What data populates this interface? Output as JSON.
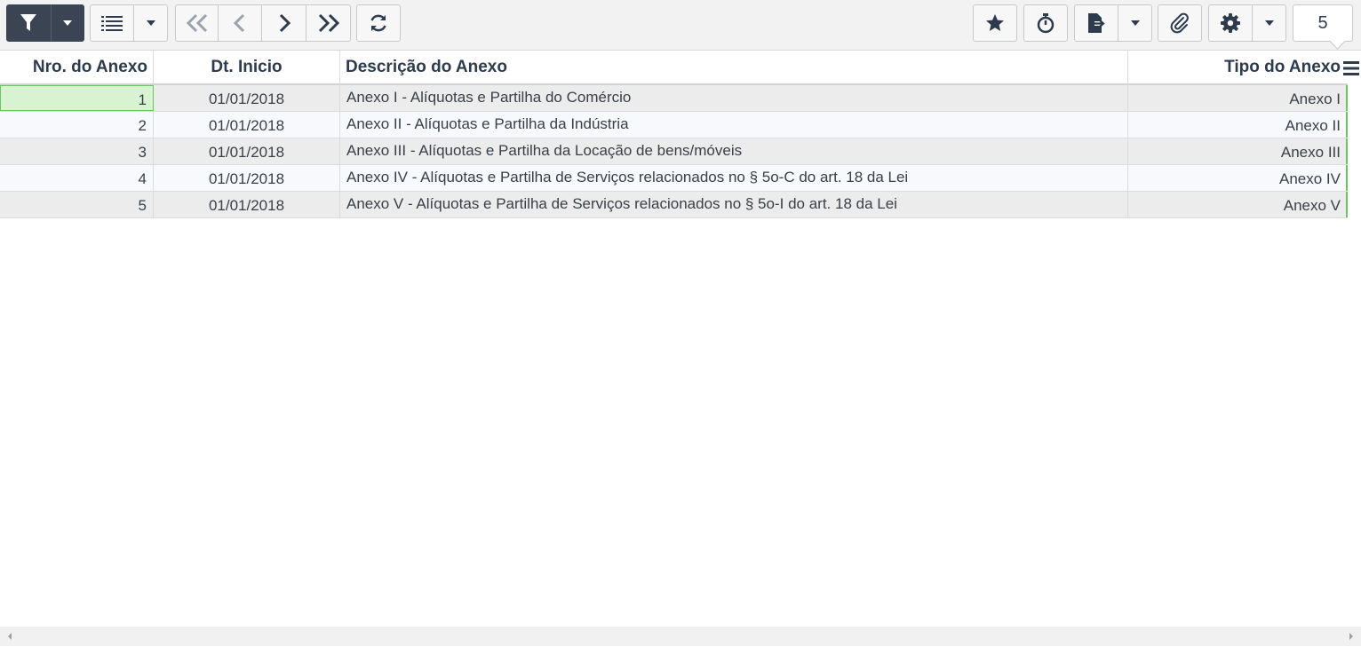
{
  "toolbar": {
    "buttons": [
      {
        "name": "filter-button",
        "icon": "filter-icon"
      },
      {
        "name": "filter-dropdown-button",
        "icon": "caret-down-icon"
      },
      {
        "name": "list-view-button",
        "icon": "list-icon"
      },
      {
        "name": "list-view-dropdown-button",
        "icon": "caret-down-icon"
      },
      {
        "name": "first-page-button",
        "icon": "double-chevron-left-icon"
      },
      {
        "name": "previous-page-button",
        "icon": "chevron-left-icon"
      },
      {
        "name": "next-page-button",
        "icon": "chevron-right-icon"
      },
      {
        "name": "last-page-button",
        "icon": "double-chevron-right-icon"
      },
      {
        "name": "refresh-button",
        "icon": "refresh-icon"
      },
      {
        "name": "favorite-button",
        "icon": "star-icon"
      },
      {
        "name": "timer-button",
        "icon": "stopwatch-icon"
      },
      {
        "name": "export-button",
        "icon": "file-export-icon"
      },
      {
        "name": "export-dropdown-button",
        "icon": "caret-down-icon"
      },
      {
        "name": "attachment-button",
        "icon": "paperclip-icon"
      },
      {
        "name": "settings-button",
        "icon": "gear-icon"
      },
      {
        "name": "settings-dropdown-button",
        "icon": "caret-down-icon"
      }
    ],
    "record_count": "5"
  },
  "table": {
    "columns": [
      "Nro. do Anexo",
      "Dt. Inicio",
      "Descrição do Anexo",
      "Tipo do Anexo"
    ],
    "rows": [
      {
        "nro": "1",
        "dt": "01/01/2018",
        "desc": "Anexo I - Alíquotas e Partilha do Comércio",
        "tipo": "Anexo I"
      },
      {
        "nro": "2",
        "dt": "01/01/2018",
        "desc": "Anexo II - Alíquotas e Partilha da Indústria",
        "tipo": "Anexo II"
      },
      {
        "nro": "3",
        "dt": "01/01/2018",
        "desc": "Anexo III - Alíquotas e Partilha da Locação de bens/móveis",
        "tipo": "Anexo III"
      },
      {
        "nro": "4",
        "dt": "01/01/2018",
        "desc": "Anexo IV - Alíquotas e Partilha de Serviços relacionados no § 5o-C do art. 18 da Lei",
        "tipo": "Anexo IV"
      },
      {
        "nro": "5",
        "dt": "01/01/2018",
        "desc": "Anexo V - Alíquotas e Partilha de Serviços relacionados no § 5o-I do art. 18 da Lei",
        "tipo": "Anexo V"
      }
    ],
    "selected_row": 0
  },
  "colors": {
    "accent": "#3a4453",
    "selection": "#d7f3d1",
    "selection_border": "#6cc463"
  }
}
